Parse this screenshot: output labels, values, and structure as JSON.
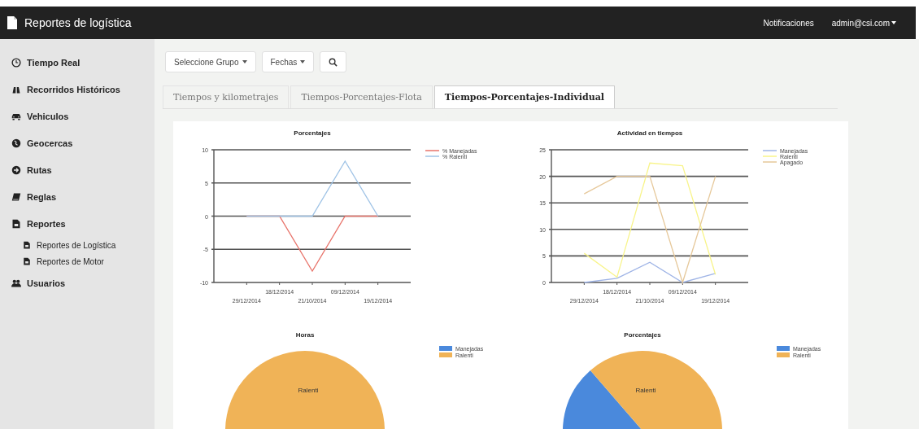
{
  "header": {
    "title": "Reportes de logística",
    "links": [
      {
        "label": "Notificaciones",
        "dropdown": false
      },
      {
        "label": "admin@csi.com",
        "dropdown": true
      }
    ]
  },
  "sidebar": {
    "items": [
      {
        "label": "Tiempo Real"
      },
      {
        "label": "Recorridos Históricos"
      },
      {
        "label": "Vehiculos"
      },
      {
        "label": "Geocercas"
      },
      {
        "label": "Rutas"
      },
      {
        "label": "Reglas"
      },
      {
        "label": "Reportes",
        "children": [
          {
            "label": "Reportes de Logística"
          },
          {
            "label": "Reportes de Motor"
          }
        ]
      },
      {
        "label": "Usuarios"
      }
    ]
  },
  "toolbar": [
    {
      "kind": "dropdown",
      "label": "Seleccione Grupo"
    },
    {
      "kind": "dropdown",
      "label": "Fechas"
    },
    {
      "kind": "search"
    }
  ],
  "tabs": [
    {
      "label": "Tiempos y kilometrajes",
      "selected": false
    },
    {
      "label": "Tiempos-Porcentajes-Flota",
      "selected": false
    },
    {
      "label": "Tiempos-Porcentajes-Individual",
      "selected": true
    }
  ],
  "charts": [
    {
      "chart_data": {
        "type": "line",
        "title": "Porcentajes",
        "categories": [
          "29/12/2014",
          "18/12/2014",
          "21/10/2014",
          "09/12/2014",
          "19/12/2014"
        ],
        "ylim": [
          -10,
          10
        ],
        "grid": true,
        "legend": true,
        "yticks": [
          -10,
          -5,
          0,
          5,
          10
        ],
        "series": [
          {
            "name": "% Manejadas",
            "color": "#e8736a",
            "values": [
              0,
              0,
              -8.3,
              0,
              0
            ]
          },
          {
            "name": "% Ralenti",
            "color": "#9fc3e6",
            "values": [
              0,
              0,
              0,
              8.3,
              0
            ]
          }
        ]
      }
    },
    {
      "chart_data": {
        "type": "line",
        "title": "Actividad en tiempos",
        "categories": [
          "29/12/2014",
          "18/12/2014",
          "21/10/2014",
          "09/12/2014",
          "19/12/2014"
        ],
        "ylim": [
          0,
          25
        ],
        "grid": true,
        "legend": true,
        "yticks": [
          0,
          5,
          10,
          15,
          20,
          25
        ],
        "series": [
          {
            "name": "Manejadas",
            "color": "#9fb4e6",
            "values": [
              0,
              0.8,
              3.8,
              0,
              1.7
            ]
          },
          {
            "name": "Ralenti",
            "color": "#f8f48a",
            "values": [
              5.5,
              1,
              22.5,
              22,
              1.5
            ]
          },
          {
            "name": "Apagado",
            "color": "#e6c89a",
            "values": [
              16.7,
              20,
              20,
              0,
              20
            ]
          }
        ]
      }
    },
    {
      "chart_data": {
        "type": "pie",
        "title": "Horas",
        "categories": [
          "Manejadas",
          "Ralenti"
        ],
        "values": [
          0,
          100
        ],
        "colors": [
          "#4a89dc",
          "#f0b357"
        ],
        "legend": true,
        "annotations": [
          {
            "text": "Ralenti"
          }
        ]
      }
    },
    {
      "chart_data": {
        "type": "pie",
        "title": "Porcentajes",
        "categories": [
          "Manejadas",
          "Ralenti"
        ],
        "values": [
          16.7,
          83.3
        ],
        "colors": [
          "#4a89dc",
          "#f0b357"
        ],
        "legend": true,
        "annotations": [
          {
            "text": "Ralenti"
          }
        ]
      }
    }
  ]
}
